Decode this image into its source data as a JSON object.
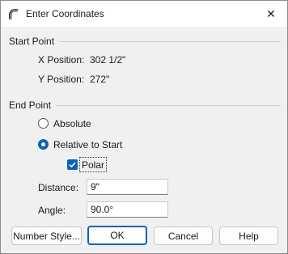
{
  "window": {
    "title": "Enter Coordinates",
    "close_glyph": "✕"
  },
  "start_point": {
    "label": "Start Point",
    "x_label": "X Position:",
    "x_value": "302 1/2\"",
    "y_label": "Y Position:",
    "y_value": "272\""
  },
  "end_point": {
    "label": "End Point",
    "absolute_label": "Absolute",
    "relative_label": "Relative to Start",
    "polar_label": "Polar",
    "selected_mode": "Relative to Start",
    "polar_checked": true,
    "distance_label": "Distance:",
    "distance_value": "9\"",
    "angle_label": "Angle:",
    "angle_value": "90.0°"
  },
  "buttons": {
    "number_style": "Number Style...",
    "ok": "OK",
    "cancel": "Cancel",
    "help": "Help"
  },
  "colors": {
    "accent": "#0a64b4",
    "background": "#f0f0f0"
  },
  "icons": {
    "app": "arc-icon",
    "close": "close-icon",
    "check": "check-icon"
  }
}
